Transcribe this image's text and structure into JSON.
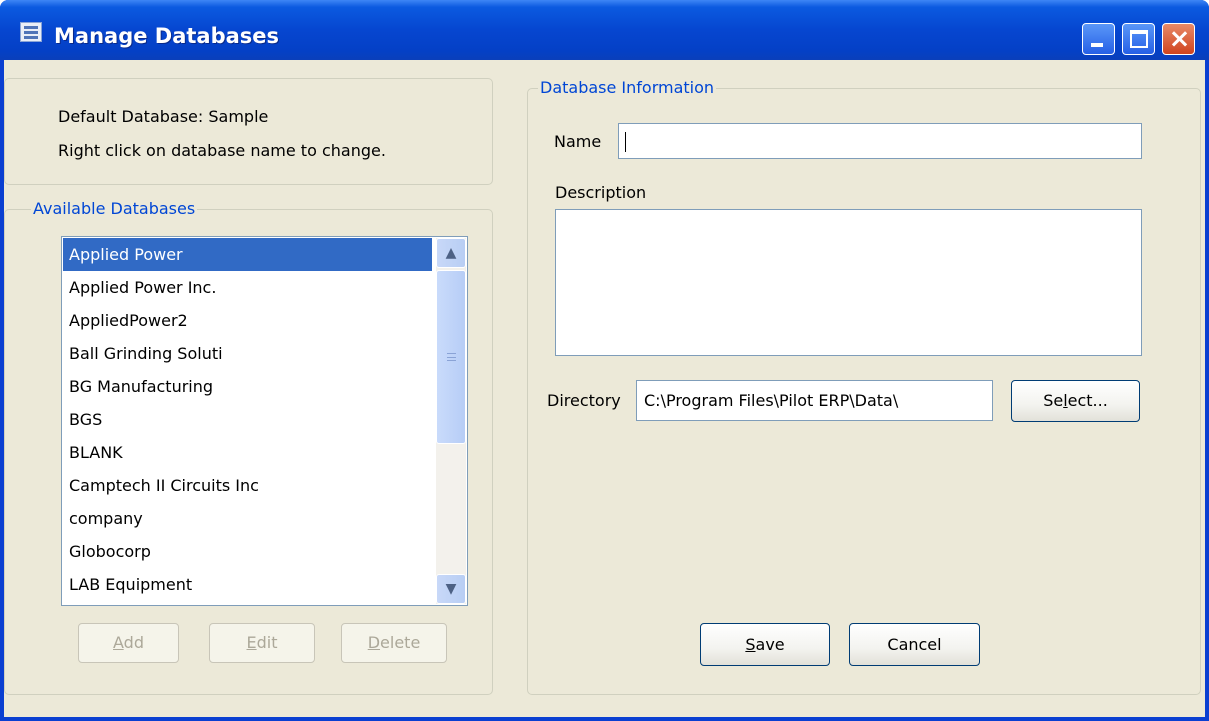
{
  "window": {
    "title": "Manage Databases",
    "controls": {
      "minimize": "minimize",
      "maximize": "maximize",
      "close": "×"
    }
  },
  "info": {
    "default_database": "Default Database: Sample",
    "hint": "Right click on database name to change."
  },
  "available": {
    "legend": "Available Databases",
    "items": [
      "Applied Power",
      "Applied Power Inc.",
      "AppliedPower2",
      "Ball Grinding Soluti",
      "BG Manufacturing",
      "BGS",
      "BLANK",
      "Camptech II Circuits Inc",
      "company",
      "Globocorp",
      "LAB Equipment"
    ],
    "selected_index": 0,
    "buttons": {
      "add": {
        "mnemonic": "A",
        "rest": "dd"
      },
      "edit": {
        "mnemonic": "E",
        "rest": "dit"
      },
      "delete": {
        "mnemonic": "D",
        "rest": "elete"
      }
    }
  },
  "db_info": {
    "legend": "Database Information",
    "name_label": "Name",
    "name_value": "",
    "description_label": "Description",
    "description_value": "",
    "directory_label": "Directory",
    "directory_value": "C:\\Program Files\\Pilot ERP\\Data\\",
    "select_button": {
      "before": "Se",
      "mnemonic": "l",
      "after": "ect..."
    },
    "save_button": {
      "mnemonic": "S",
      "rest": "ave"
    },
    "cancel_button": "Cancel"
  },
  "colors": {
    "titlebar": "#0646d0",
    "selection": "#316ac5",
    "legend_text": "#0046d5",
    "dialog_bg": "#ece9d8"
  },
  "icons": [
    "app-icon",
    "minimize-icon",
    "maximize-icon",
    "close-icon",
    "scroll-up-arrow-icon",
    "scroll-down-arrow-icon"
  ]
}
